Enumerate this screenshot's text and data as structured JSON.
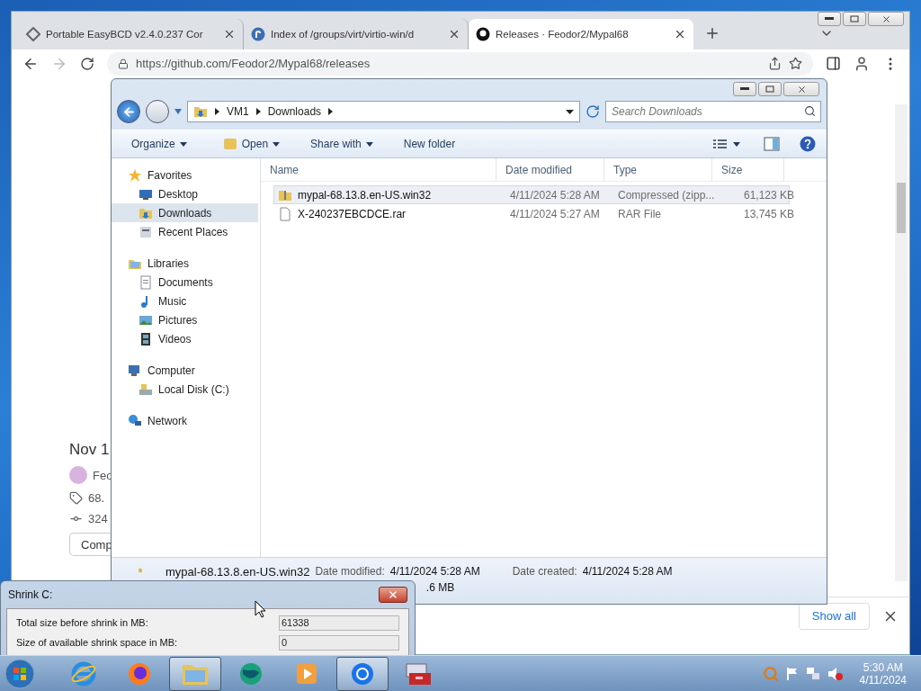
{
  "browser": {
    "tabs": [
      {
        "title": "Portable EasyBCD v2.4.0.237 Cor",
        "selected": false
      },
      {
        "title": "Index of /groups/virt/virtio-win/d",
        "selected": false
      },
      {
        "title": "Releases · Feodor2/Mypal68",
        "selected": true
      }
    ],
    "url": "https://github.com/Feodor2/Mypal68/releases",
    "page": {
      "date": "Nov 1",
      "author": "Feo",
      "tag": "68.",
      "commit": "324",
      "button": "Comp"
    },
    "downloads_bar": {
      "show_all": "Show all"
    }
  },
  "explorer": {
    "breadcrumb": [
      "VM1",
      "Downloads"
    ],
    "search": {
      "placeholder": "Search Downloads"
    },
    "toolbar": [
      {
        "label": "Organize",
        "has_menu": true
      },
      {
        "label": "Open",
        "has_menu": true
      },
      {
        "label": "Share with",
        "has_menu": true
      },
      {
        "label": "New folder",
        "has_menu": false
      }
    ],
    "nav": [
      {
        "label": "Favorites",
        "selected": false,
        "children": [
          {
            "label": "Desktop",
            "selected": false
          },
          {
            "label": "Downloads",
            "selected": true
          },
          {
            "label": "Recent Places",
            "selected": false
          }
        ]
      },
      {
        "label": "Libraries",
        "selected": false,
        "children": [
          {
            "label": "Documents",
            "selected": false
          },
          {
            "label": "Music",
            "selected": false
          },
          {
            "label": "Pictures",
            "selected": false
          },
          {
            "label": "Videos",
            "selected": false
          }
        ]
      },
      {
        "label": "Computer",
        "selected": false,
        "children": [
          {
            "label": "Local Disk (C:)",
            "selected": false
          }
        ]
      },
      {
        "label": "Network",
        "selected": false
      }
    ],
    "columns": [
      "Name",
      "Date modified",
      "Type",
      "Size"
    ],
    "files": [
      {
        "name": "mypal-68.13.8.en-US.win32",
        "date": "4/11/2024 5:28 AM",
        "type": "Compressed (zipp...",
        "size": "61,123 KB",
        "kind": "zip",
        "selected": true
      },
      {
        "name": "X-240237EBCDCE.rar",
        "date": "4/11/2024 5:27 AM",
        "type": "RAR File",
        "size": "13,745 KB",
        "kind": "file",
        "selected": false
      }
    ],
    "details": {
      "name": "mypal-68.13.8.en-US.win32",
      "modified_label": "Date modified:",
      "modified": "4/11/2024 5:28 AM",
      "created_label": "Date created:",
      "created": "4/11/2024 5:28 AM",
      "size": ".6 MB"
    }
  },
  "dialog": {
    "title": "Shrink C:",
    "fields": [
      {
        "label": "Total size before shrink in MB:",
        "value": "61338"
      },
      {
        "label": "Size of available shrink space in MB:",
        "value": "0"
      }
    ]
  },
  "taskbar": {
    "apps": [
      {
        "kind": "ie",
        "selected": false
      },
      {
        "kind": "firefox",
        "selected": false
      },
      {
        "kind": "folder",
        "selected": true
      },
      {
        "kind": "globe",
        "selected": false
      },
      {
        "kind": "media",
        "selected": false
      },
      {
        "kind": "chrome",
        "selected": true
      },
      {
        "kind": "toolbox",
        "selected": false
      }
    ],
    "time": "5:30 AM",
    "date": "4/11/2024"
  }
}
